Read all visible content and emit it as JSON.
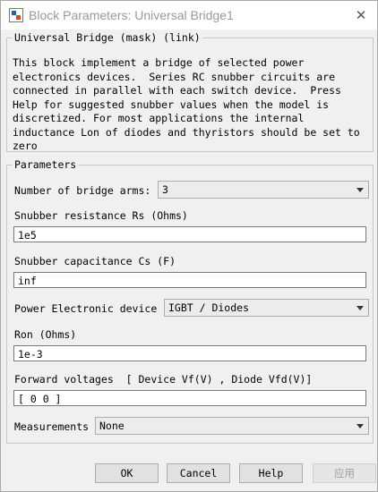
{
  "window": {
    "title": "Block Parameters: Universal Bridge1",
    "close_icon": "close-icon"
  },
  "description_group": {
    "title": "Universal Bridge (mask) (link)",
    "text": "This block implement a bridge of selected power\nelectronics devices.  Series RC snubber circuits are\nconnected in parallel with each switch device.  Press\nHelp for suggested snubber values when the model is\ndiscretized. For most applications the internal\ninductance Lon of diodes and thyristors should be set to\nzero"
  },
  "parameters": {
    "title": "Parameters",
    "bridge_arms": {
      "label": "Number of bridge arms:",
      "value": "3"
    },
    "snubber_resistance": {
      "label": "Snubber resistance Rs (Ohms)",
      "value": "1e5"
    },
    "snubber_capacitance": {
      "label": "Snubber capacitance Cs (F)",
      "value": "inf"
    },
    "power_device": {
      "label": "Power Electronic device",
      "value": "IGBT / Diodes"
    },
    "ron": {
      "label": "Ron (Ohms)",
      "value": "1e-3"
    },
    "forward_voltages": {
      "label": "Forward voltages  [ Device Vf(V) , Diode Vfd(V)]",
      "value": "[  0  0  ]"
    },
    "measurements": {
      "label": "Measurements",
      "value": "None"
    }
  },
  "buttons": {
    "ok": "OK",
    "cancel": "Cancel",
    "help": "Help",
    "apply": "应用"
  }
}
